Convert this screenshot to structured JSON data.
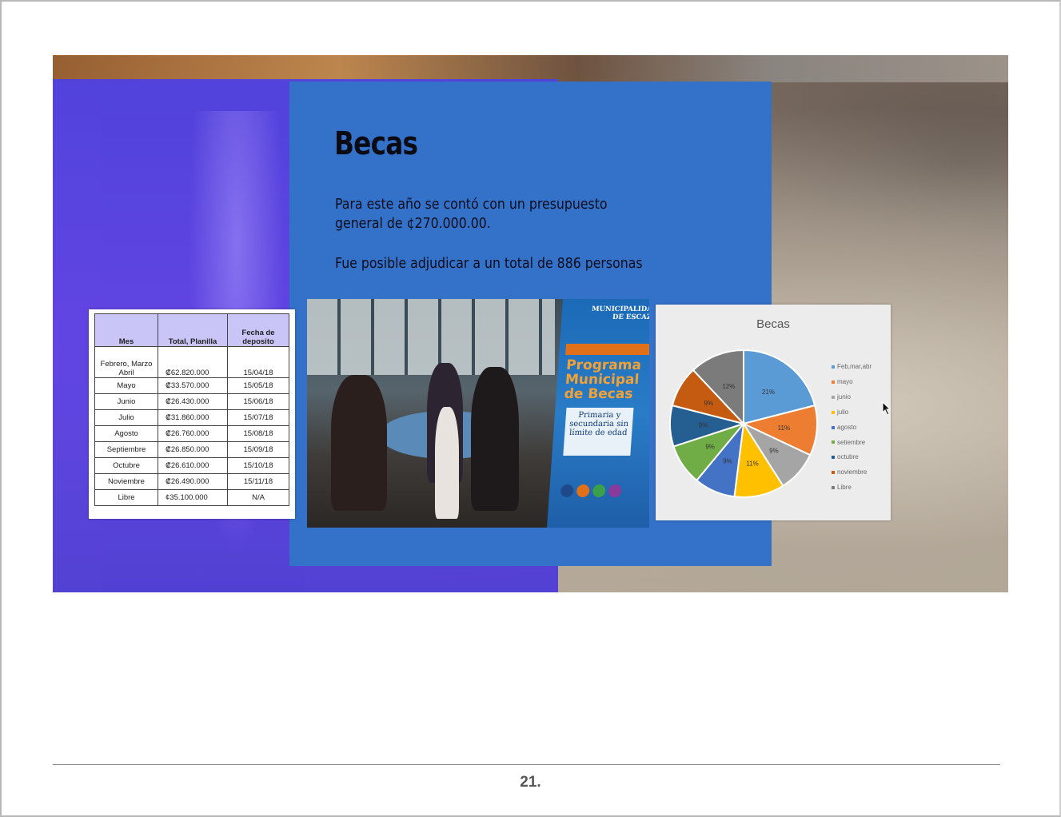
{
  "slide": {
    "title": "Becas",
    "paragraph_1": "Para este año se contó con un presupuesto general de ¢270.000.00.",
    "paragraph_2": "Fue posible adjudicar a un total de 886 personas"
  },
  "table": {
    "headers": [
      "Mes",
      "Total, Planilla",
      "Fecha de deposito"
    ],
    "rows": [
      [
        "Febrero, Marzo Abril",
        "₡62.820.000",
        "15/04/18"
      ],
      [
        "Mayo",
        "₡33.570.000",
        "15/05/18"
      ],
      [
        "Junio",
        "₡26.430.000",
        "15/06/18"
      ],
      [
        "Julio",
        "₡31.860.000",
        "15/07/18"
      ],
      [
        "Agosto",
        "₡26.760.000",
        "15/08/18"
      ],
      [
        "Septiembre",
        "₡26.850.000",
        "15/09/18"
      ],
      [
        "Octubre",
        "₡26.610.000",
        "15/10/18"
      ],
      [
        "Noviembre",
        "₡26.490.000",
        "15/11/18"
      ],
      [
        "Libre",
        "¢35.100.000",
        "N/A"
      ]
    ]
  },
  "photo_banner": {
    "municipality": "MUNICIPALIDAD DE ESCAZÚ",
    "program": "Programa Municipal de Becas",
    "card": "Primaria y secundaria sin límite de edad"
  },
  "chart_data": {
    "type": "pie",
    "title": "Becas",
    "legend_position": "right",
    "slices": [
      {
        "label": "Feb,mar,abr",
        "value": 21,
        "display": "21%",
        "color": "#5b9bd5"
      },
      {
        "label": "mayo",
        "value": 11,
        "display": "11%",
        "color": "#ed7d31"
      },
      {
        "label": "junio",
        "value": 9,
        "display": "9%",
        "color": "#a5a5a5"
      },
      {
        "label": "julio",
        "value": 11,
        "display": "11%",
        "color": "#ffc000"
      },
      {
        "label": "agosto",
        "value": 9,
        "display": "9%",
        "color": "#4472c4"
      },
      {
        "label": "setiembre",
        "value": 9,
        "display": "9%",
        "color": "#70ad47"
      },
      {
        "label": "octubre",
        "value": 9,
        "display": "9%",
        "color": "#255e91"
      },
      {
        "label": "noviembre",
        "value": 9,
        "display": "9%",
        "color": "#c55a11"
      },
      {
        "label": "Libre",
        "value": 12,
        "display": "12%",
        "color": "#7b7b7b"
      }
    ]
  },
  "footer": {
    "page_number": "21."
  }
}
